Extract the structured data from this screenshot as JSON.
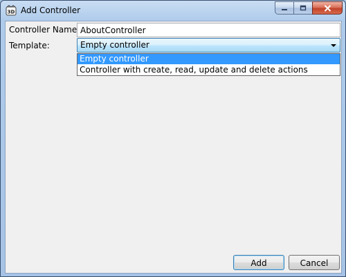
{
  "window": {
    "title": "Add Controller",
    "caption": {
      "minimize_icon": "minimize-icon",
      "maximize_icon": "maximize-icon",
      "close_icon": "close-icon"
    }
  },
  "form": {
    "controller_name_label": "Controller Name:",
    "controller_name_value": "AboutController",
    "template_label": "Template:",
    "template_selected": "Empty controller",
    "template_options": [
      "Empty controller",
      "Controller with create, read, update and delete actions"
    ]
  },
  "buttons": {
    "add": "Add",
    "cancel": "Cancel"
  },
  "colors": {
    "selection": "#3399ff",
    "focus_border": "#3c7fb1"
  }
}
